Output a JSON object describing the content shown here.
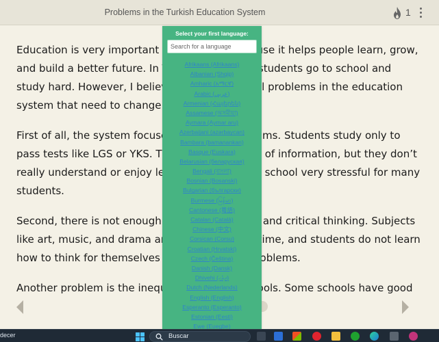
{
  "header": {
    "title": "Problems in the Turkish Education System",
    "streak_count": "1",
    "icons": {
      "streak": "fire-icon",
      "menu": "kebab-menu-icon"
    }
  },
  "article": {
    "paragraphs": [
      "Education is very important for a country because it helps people learn, grow, and build a better future. In Turkey, millions of students go to school and study hard. However, I believe there are several problems in the education system that need to change.",
      "First of all, the system focuses too much on exams. Students study only to pass tests like LGS or YKS. They memorize a lot of information, but they don’t really understand or enjoy learning. This makes school very stressful for many students.",
      "Second, there is not enough focus on creativity and critical thinking. Subjects like art, music, and drama are not given much time, and students do not learn how to think for themselves or solve real-life problems.",
      "Another problem is the inequality between schools. Some schools have good"
    ]
  },
  "language_picker": {
    "heading": "Select your first language:",
    "search_placeholder": "Search for a language",
    "languages": [
      "Afrikaans (Afrikaans)",
      "Albanian (Shqip)",
      "Amharic (አማርኛ)",
      "Arabic (عربي)",
      "Armenian (Հայերեն)",
      "Assamese (অসমীয়া)",
      "Aymara (Aymar aru)",
      "Azerbaijani (azərbaycan)",
      "Bambara (bamanankan)",
      "Basque (Euskara)",
      "Belarusian (беларуская)",
      "Bengali (বাংলা)",
      "Bosnian (Bosanski)",
      "Bulgarian (български)",
      "Burmese (မြန်မာ)",
      "Cantonese (粵語)",
      "Catalan (Català)",
      "Chinese (中文)",
      "Corsican (Corsu)",
      "Croatian (Hrvatski)",
      "Czech (Čeština)",
      "Danish (Dansk)",
      "Dhivehi (ދިވެހި)",
      "Dutch (Nederlands)",
      "English (English)",
      "Esperanto (Esperanto)",
      "Estonian (Eesti)",
      "Ewe (Eʋegbe)"
    ]
  },
  "navigation": {
    "prev_icon": "chevron-left-icon",
    "next_icon": "chevron-right-icon"
  },
  "taskbar": {
    "corner_text": "decer",
    "search_label": "Buscar",
    "icons": [
      "windows-icon",
      "search-icon",
      "file-explorer-icon",
      "app-icon",
      "store-icon",
      "opera-icon",
      "folder-icon",
      "xbox-icon",
      "edge-icon",
      "calculator-icon",
      "app-icon-2"
    ]
  }
}
